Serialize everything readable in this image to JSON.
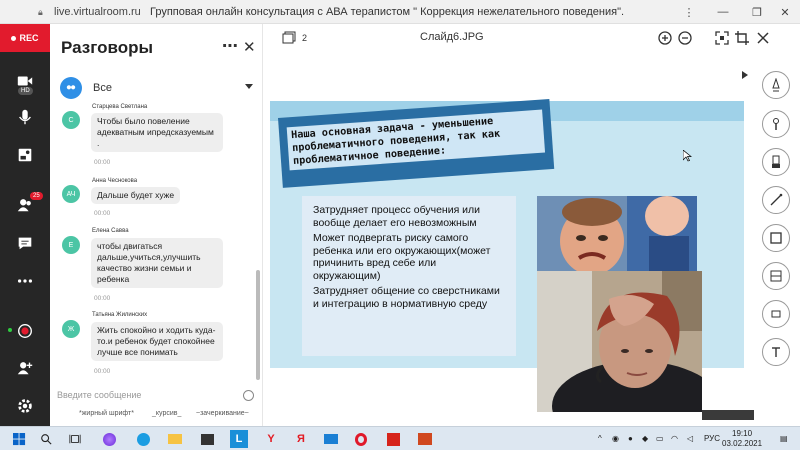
{
  "browser": {
    "url": "live.virtualroom.ru",
    "title": "Групповая онлайн консультация с АВА терапистом \" Коррекция нежелательного поведения\"."
  },
  "rail": {
    "rec_label": "REC",
    "cam_badge": "HD",
    "participants_count": "25"
  },
  "chat": {
    "title": "Разговоры",
    "filter_label": "Все",
    "messages": [
      {
        "name": "Старцева Светлана",
        "avatar": "С",
        "text": "Чтобы было повеление адекватным ипредсказуемым .",
        "time": "00:00"
      },
      {
        "name": "Анна Чеснокова",
        "avatar": "АЧ",
        "text": "Дальше будет хуже",
        "time": "00:00"
      },
      {
        "name": "Елена Савва",
        "avatar": "Е",
        "text": "чтобы двигаться дальше,учиться,улучшить качество жизни семьи и ребенка",
        "time": "00:00"
      },
      {
        "name": "Татьяна Жилинских",
        "avatar": "Ж",
        "text": "Жить спокойно и ходить куда-то.и ребенок будет спокойнее лучше все понимать",
        "time": "00:00"
      }
    ],
    "composer_placeholder": "Введите сообщение",
    "format_bold": "*жирный шрифт*",
    "format_italic": "_курсив_",
    "format_strike": "~зачеркивание~"
  },
  "viewer": {
    "page_count": "2",
    "file_name": "Слайд6.JPG"
  },
  "slide": {
    "heading": "Наша основная задача - уменьшение проблематичного поведения, так как проблематичное поведение:",
    "points": [
      "Затрудняет процесс обучения или вообще делает его невозможным",
      "Может подвергать риску самого ребенка или его окружающих(может причинить вред себе или окружающим)",
      "Затрудняет общение со сверстниками и интеграцию в нормативную среду"
    ]
  },
  "taskbar": {
    "lang": "РУС",
    "time": "19:10",
    "date": "03.02.2021"
  },
  "colors": {
    "accent_red": "#e21b2d",
    "rail_bg": "#262626",
    "avatar_green": "#4cc5a5",
    "filter_blue": "#2f8fe6",
    "slide_bg": "#c8e6f2"
  }
}
